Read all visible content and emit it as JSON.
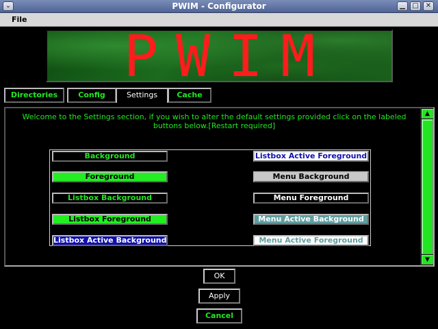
{
  "window": {
    "title": "PWIM - Configurator",
    "menu_icon": "chevron-down-icon",
    "minimize_icon": "minimize-icon",
    "maximize_icon": "maximize-icon",
    "close_icon": "close-icon"
  },
  "menubar": {
    "file_label": "File"
  },
  "banner": {
    "logo_text": "PWIM"
  },
  "tabs": [
    {
      "label": "Directories",
      "active": false
    },
    {
      "label": "Config",
      "active": false
    },
    {
      "label": "Settings",
      "active": true
    },
    {
      "label": "Cache",
      "active": false
    }
  ],
  "settings": {
    "welcome_text": "Welcome to the Settings section, if you wish to alter the default settings provided click on the labeled buttons below.[Restart required]",
    "left_buttons": [
      "Background",
      "Foreground",
      "Listbox Background",
      "Listbox Foreground",
      "Listbox Active Background"
    ],
    "right_buttons": [
      "Listbox Active Foreground",
      "Menu Background",
      "Menu Foreground",
      "Menu Active Background",
      "Menu Active Foreground"
    ]
  },
  "dialog": {
    "ok_label": "OK",
    "apply_label": "Apply",
    "cancel_label": "Cancel"
  },
  "colors": {
    "accent_green": "#22e622",
    "logo_red": "#ff1c1c",
    "title_bar": "#5a6f9f"
  }
}
